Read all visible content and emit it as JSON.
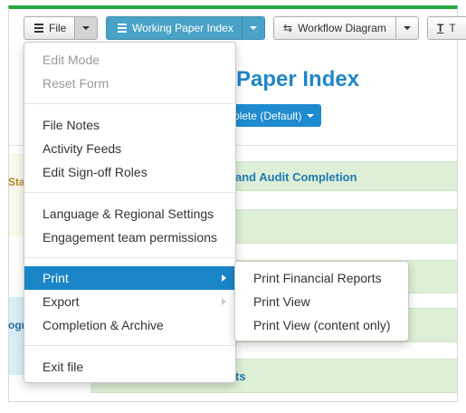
{
  "toolbar": {
    "file_label": "File",
    "working_paper_index_label": "Working Paper Index",
    "workflow_diagram_label": "Workflow Diagram",
    "truncated_label": "T"
  },
  "page": {
    "title": "Paper Index",
    "mode_button_label": "plete (Default)",
    "left_text_1": "Sta",
    "left_text_2": "ogr",
    "row_1_text": "and Audit Completion",
    "row_5_text": "ts"
  },
  "file_menu": {
    "items": [
      {
        "label": "Edit Mode",
        "disabled": true
      },
      {
        "label": "Reset Form",
        "disabled": true
      },
      {
        "label": "File Notes"
      },
      {
        "label": "Activity Feeds"
      },
      {
        "label": "Edit Sign-off Roles"
      },
      {
        "label": "Language & Regional Settings"
      },
      {
        "label": "Engagement team permissions"
      },
      {
        "label": "Print",
        "active": true,
        "has_submenu": true
      },
      {
        "label": "Export",
        "has_submenu": true
      },
      {
        "label": "Completion & Archive"
      },
      {
        "label": "Exit file"
      }
    ]
  },
  "print_submenu": {
    "items": [
      {
        "label": "Print Financial Reports"
      },
      {
        "label": "Print View"
      },
      {
        "label": "Print View (content only)"
      }
    ]
  },
  "colors": {
    "accent_green": "#28a745",
    "menu_active": "#1a85c7",
    "primary_button": "#4aa3c6",
    "title_blue": "#1f86c8",
    "row_green": "#ddefd6"
  },
  "icons": {
    "file_button": "list-icon",
    "working_paper_index_button": "list-icon",
    "workflow_diagram_button": "workflow-icon",
    "truncated_button": "text-icon"
  }
}
